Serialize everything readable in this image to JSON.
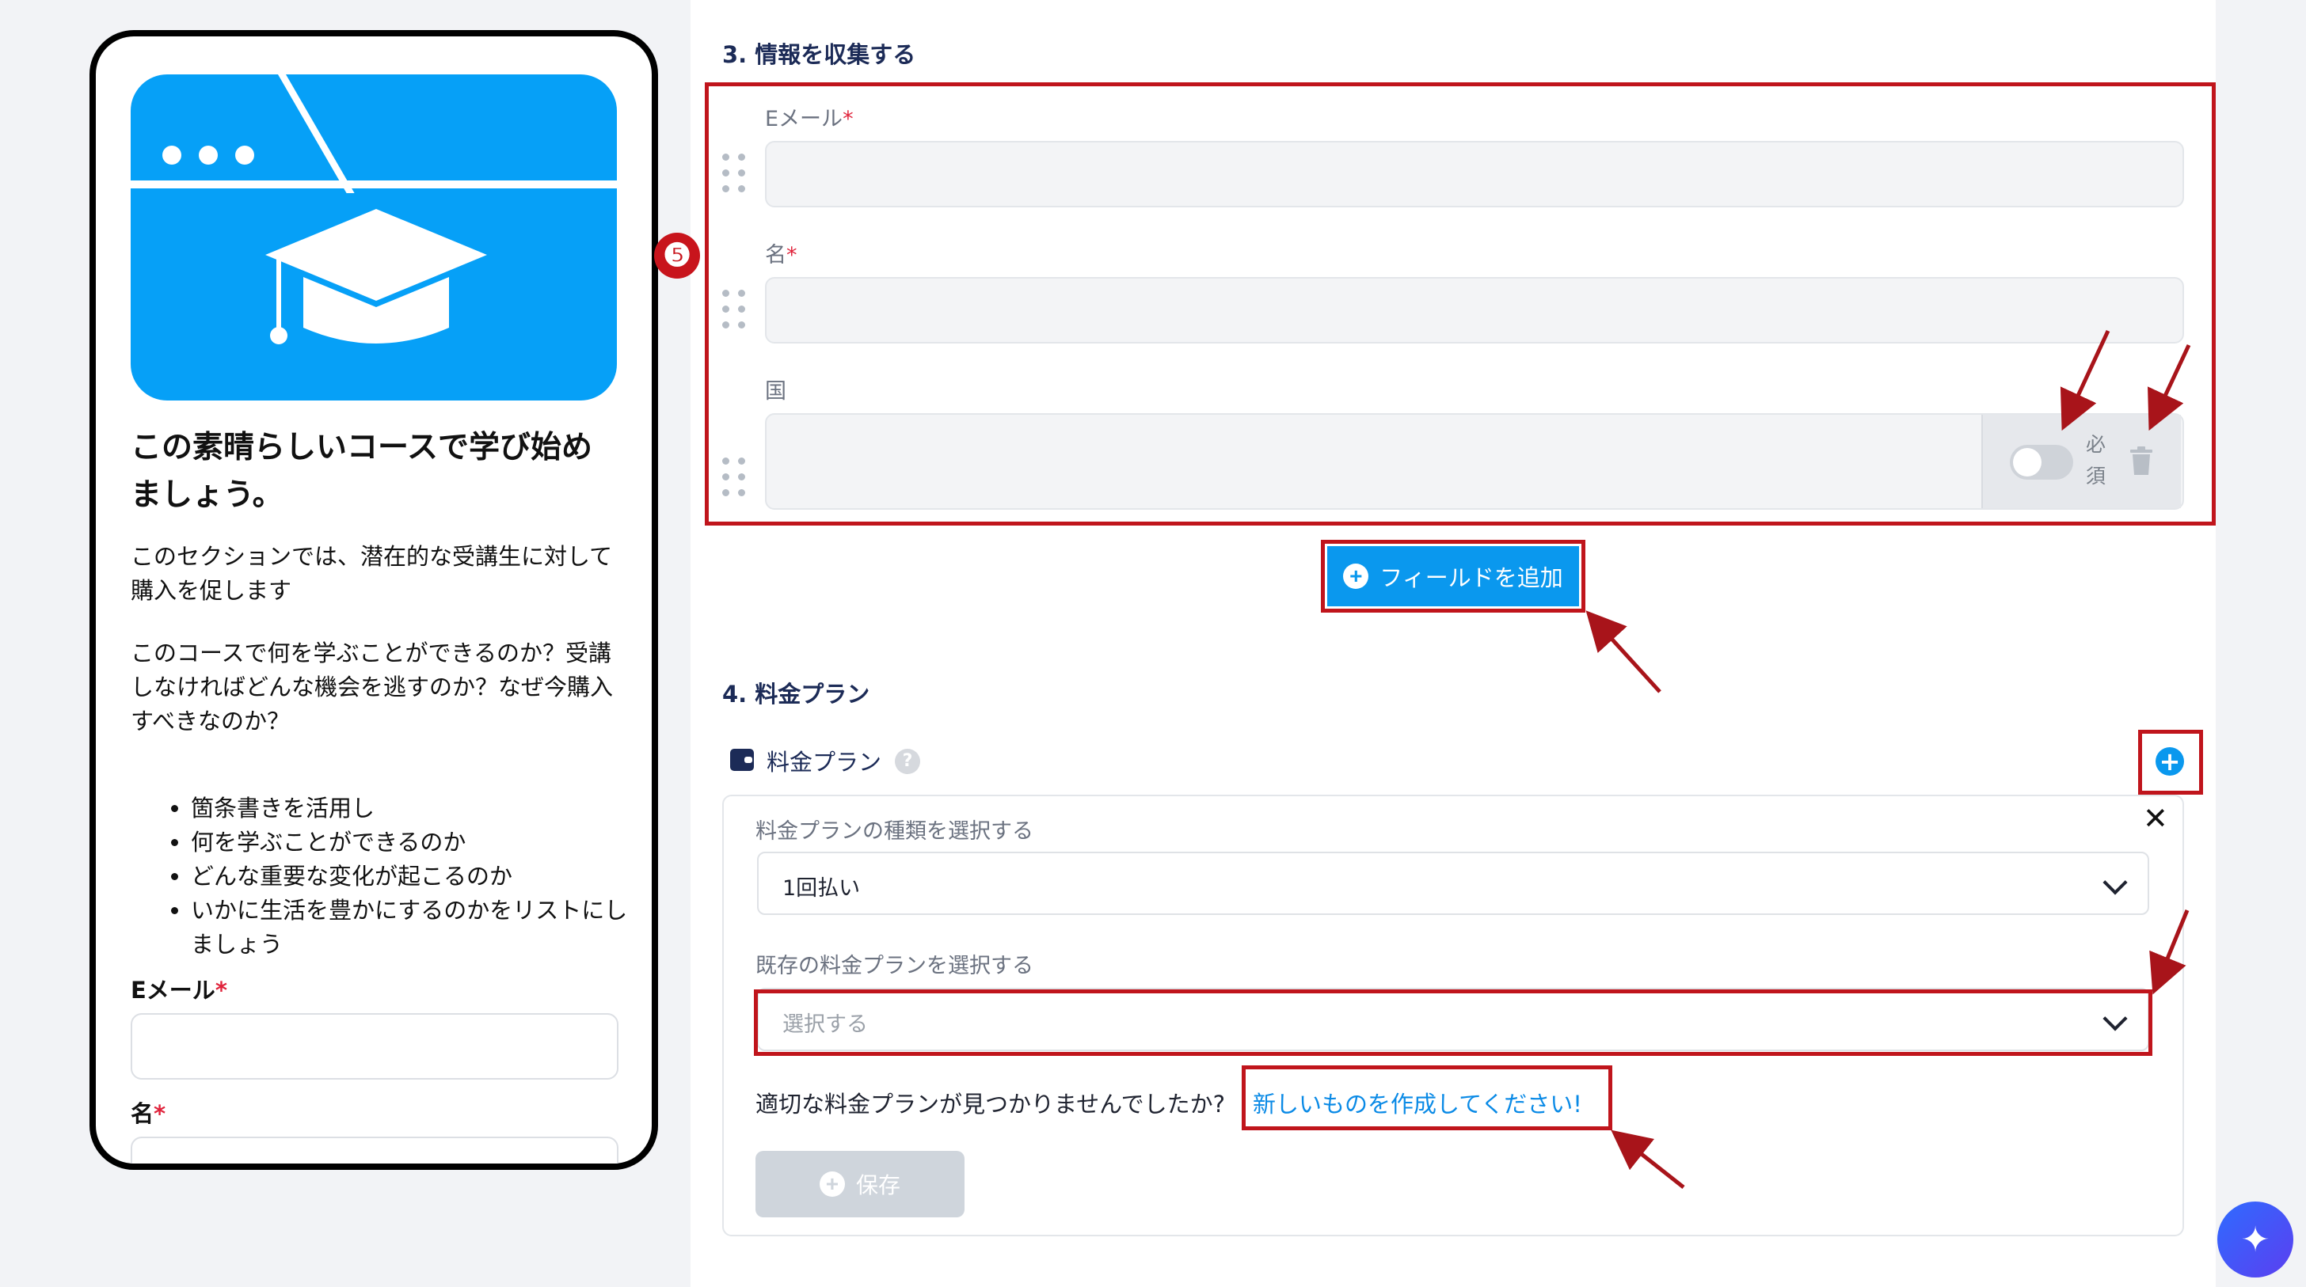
{
  "preview": {
    "title": "この素晴らしいコースで学び始めましょう。",
    "paragraph1": "このセクションでは、潜在的な受講生に対して購入を促します",
    "paragraph2": "このコースで何を学ぶことができるのか？受講しなければどんな機会を逃すのか？なぜ今購入すべきなのか？",
    "bullets": [
      "箇条書きを活用し",
      "何を学ぶことができるのか",
      "どんな重要な変化が起こるのか",
      "いかに生活を豊かにするのかをリストにしましょう"
    ],
    "email_label": "Eメール",
    "name_label": "名",
    "required_mark": "*",
    "hero_icon": "graduation-cap-icon"
  },
  "section3": {
    "title": "3. 情報を収集する",
    "fields": [
      {
        "label": "Eメール",
        "required": true
      },
      {
        "label": "名",
        "required": true
      },
      {
        "label": "国",
        "required": false
      }
    ],
    "required_toggle_label": "必須",
    "badge": "❺",
    "add_field_label": "フィールドを追加"
  },
  "section4": {
    "title": "4. 料金プラン",
    "plan_label": "料金プラン",
    "help": "?",
    "type_label": "料金プランの種類を選択する",
    "type_value": "1回払い",
    "existing_label": "既存の料金プランを選択する",
    "existing_placeholder": "選択する",
    "not_found_text": "適切な料金プランが見つかりませんでしたか?",
    "create_link": "新しいものを作成してください!",
    "save_label": "保存"
  },
  "colors": {
    "accent": "#0a98ee",
    "highlight": "#c0151c",
    "heading": "#1c2b57"
  }
}
